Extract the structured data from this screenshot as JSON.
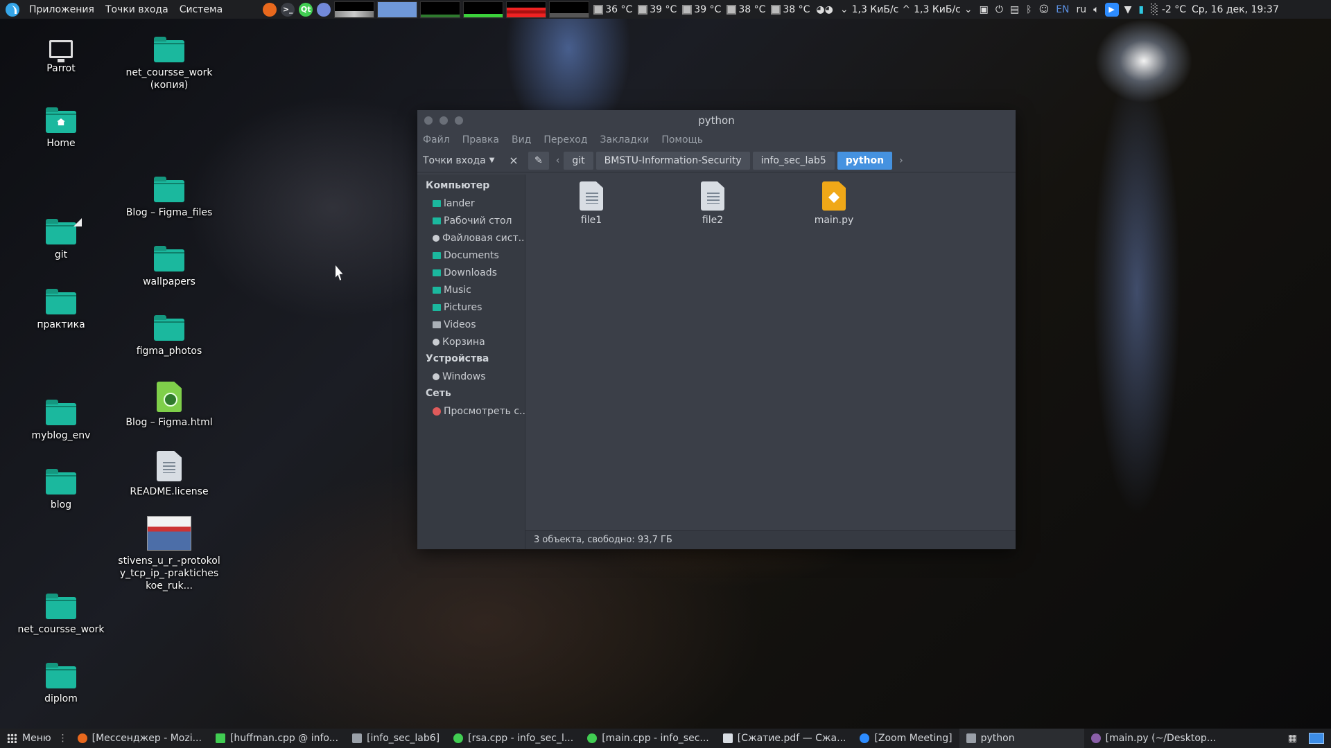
{
  "top_panel": {
    "menus": [
      "Приложения",
      "Точки входа",
      "Система"
    ],
    "temps": [
      "36 °C",
      "39 °C",
      "39 °C",
      "38 °C",
      "38 °C"
    ],
    "net_down": "1,3 КиБ/с",
    "net_up": "1,3 КиБ/с",
    "lang": "EN",
    "layout": "ru",
    "weather": "-2 °C",
    "clock": "Ср, 16 дек, 19:37"
  },
  "desktop": {
    "icons": [
      {
        "label": "Parrot"
      },
      {
        "label": "Home"
      },
      {
        "label": "git"
      },
      {
        "label": "практика"
      },
      {
        "label": "myblog_env"
      },
      {
        "label": "blog"
      },
      {
        "label": "net_coursse_work"
      },
      {
        "label": "diplom"
      },
      {
        "label": "net_coursse_work (копия)"
      },
      {
        "label": "Blog – Figma_files"
      },
      {
        "label": "wallpapers"
      },
      {
        "label": "figma_photos"
      },
      {
        "label": "Blog – Figma.html"
      },
      {
        "label": "README.license"
      },
      {
        "label": "stivens_u_r_-protokoly_tcp_ip_-prakticheskoe_ruk..."
      }
    ]
  },
  "window": {
    "title": "python",
    "menu": [
      "Файл",
      "Правка",
      "Вид",
      "Переход",
      "Закладки",
      "Помощь"
    ],
    "places_label": "Точки входа",
    "breadcrumb": [
      "git",
      "BMSTU-Information-Security",
      "info_sec_lab5",
      "python"
    ],
    "sidebar": {
      "sections": [
        {
          "title": "Компьютер",
          "items": [
            "lander",
            "Рабочий стол",
            "Файловая сист...",
            "Documents",
            "Downloads",
            "Music",
            "Pictures",
            "Videos",
            "Корзина"
          ]
        },
        {
          "title": "Устройства",
          "items": [
            "Windows"
          ]
        },
        {
          "title": "Сеть",
          "items": [
            "Просмотреть с..."
          ]
        }
      ]
    },
    "files": [
      {
        "name": "file1",
        "icon": "text-file-icon"
      },
      {
        "name": "file2",
        "icon": "text-file-icon"
      },
      {
        "name": "main.py",
        "icon": "python-file-icon"
      }
    ],
    "status": "3 объекта, свободно: 93,7 ГБ"
  },
  "bottom_panel": {
    "menu_label": "Меню",
    "tasks": [
      "[Мессенджер - Mozi...",
      "[huffman.cpp @ info...",
      "[info_sec_lab6]",
      "[rsa.cpp - info_sec_l...",
      "[main.cpp - info_sec...",
      "[Сжатие.pdf — Сжа...",
      "[Zoom Meeting]",
      "python",
      "[main.py (~/Desktop..."
    ]
  },
  "colors": {
    "folder": "#1bb89e",
    "accent": "#4592e0",
    "python_file": "#f0a818"
  }
}
